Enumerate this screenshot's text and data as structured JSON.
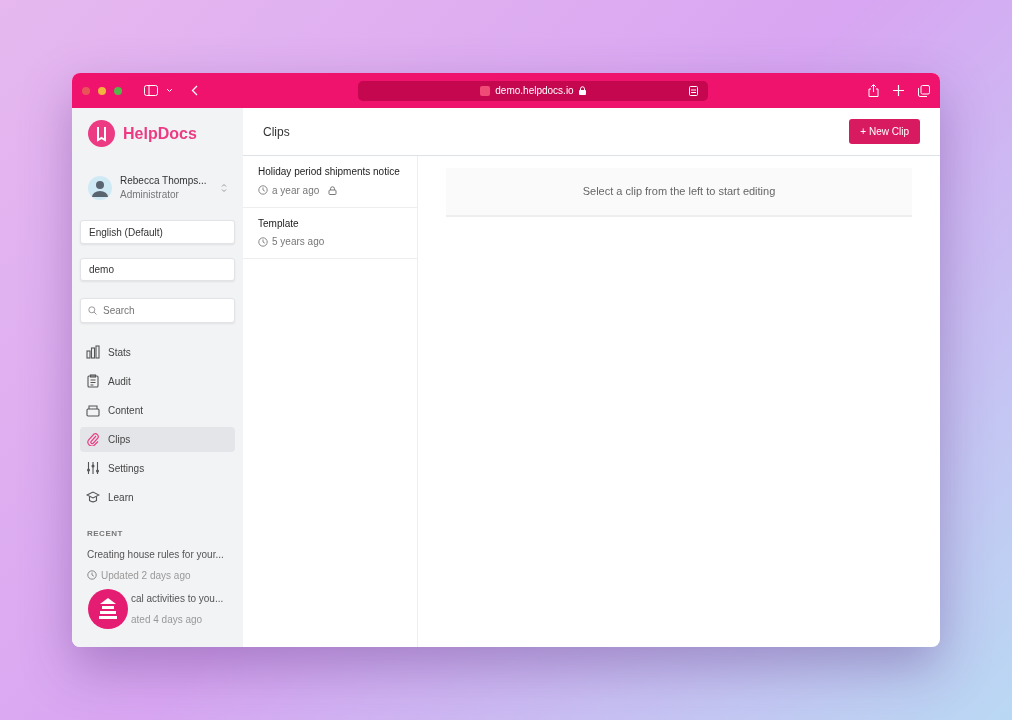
{
  "browser": {
    "url": "demo.helpdocs.io"
  },
  "brand": {
    "name": "HelpDocs"
  },
  "user": {
    "name": "Rebecca Thomps...",
    "role": "Administrator"
  },
  "language": {
    "value": "English (Default)"
  },
  "site": {
    "value": "demo"
  },
  "search": {
    "placeholder": "Search"
  },
  "nav": [
    {
      "label": "Stats",
      "selected": false
    },
    {
      "label": "Audit",
      "selected": false
    },
    {
      "label": "Content",
      "selected": false
    },
    {
      "label": "Clips",
      "selected": true
    },
    {
      "label": "Settings",
      "selected": false
    },
    {
      "label": "Learn",
      "selected": false
    }
  ],
  "recent": {
    "heading": "RECENT",
    "items": [
      {
        "title": "Creating house rules for your...",
        "updated": "Updated 2 days ago"
      },
      {
        "title": "cal activities to you...",
        "updated": "ated 4 days ago"
      }
    ]
  },
  "page": {
    "title": "Clips",
    "new_button": "+ New Clip"
  },
  "clips": [
    {
      "title": "Holiday period shipments notice",
      "time": "a year ago",
      "locked": true
    },
    {
      "title": "Template",
      "time": "5 years ago",
      "locked": false
    }
  ],
  "empty_message": "Select a clip from the left to start editing"
}
